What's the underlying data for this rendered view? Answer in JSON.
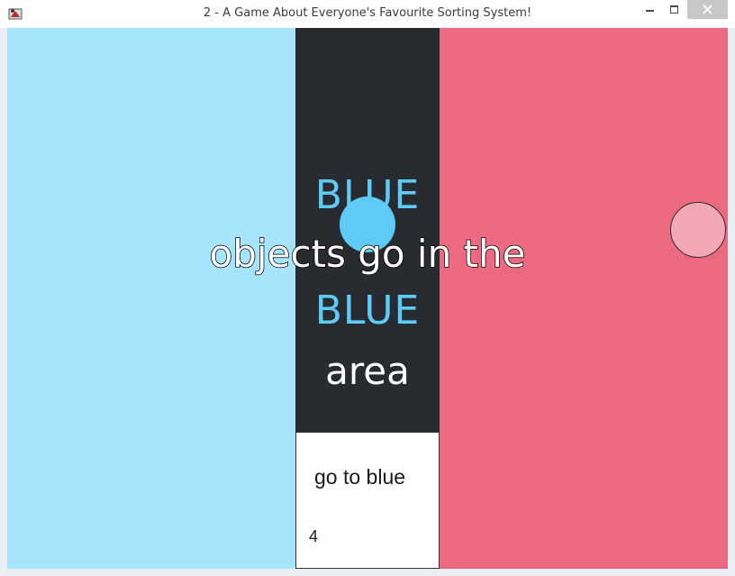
{
  "window": {
    "title": "2 - A Game About Everyone's Favourite Sorting System!",
    "icons": {
      "app": "java-app-icon",
      "minimize": "minimize-icon",
      "maximize": "maximize-icon",
      "close": "close-icon"
    }
  },
  "zones": {
    "left_color": "#a6e4fb",
    "center_color": "#282b30",
    "right_color": "#ec6a80"
  },
  "objects": {
    "blue_ball_color": "#5ecbf6",
    "pink_ball_color": "#f3a8b6"
  },
  "instruction": {
    "line1": "BLUE",
    "line2": "objects go in the",
    "line3": "BLUE",
    "line4": "area"
  },
  "panel": {
    "label": "go to blue",
    "count": "4"
  }
}
